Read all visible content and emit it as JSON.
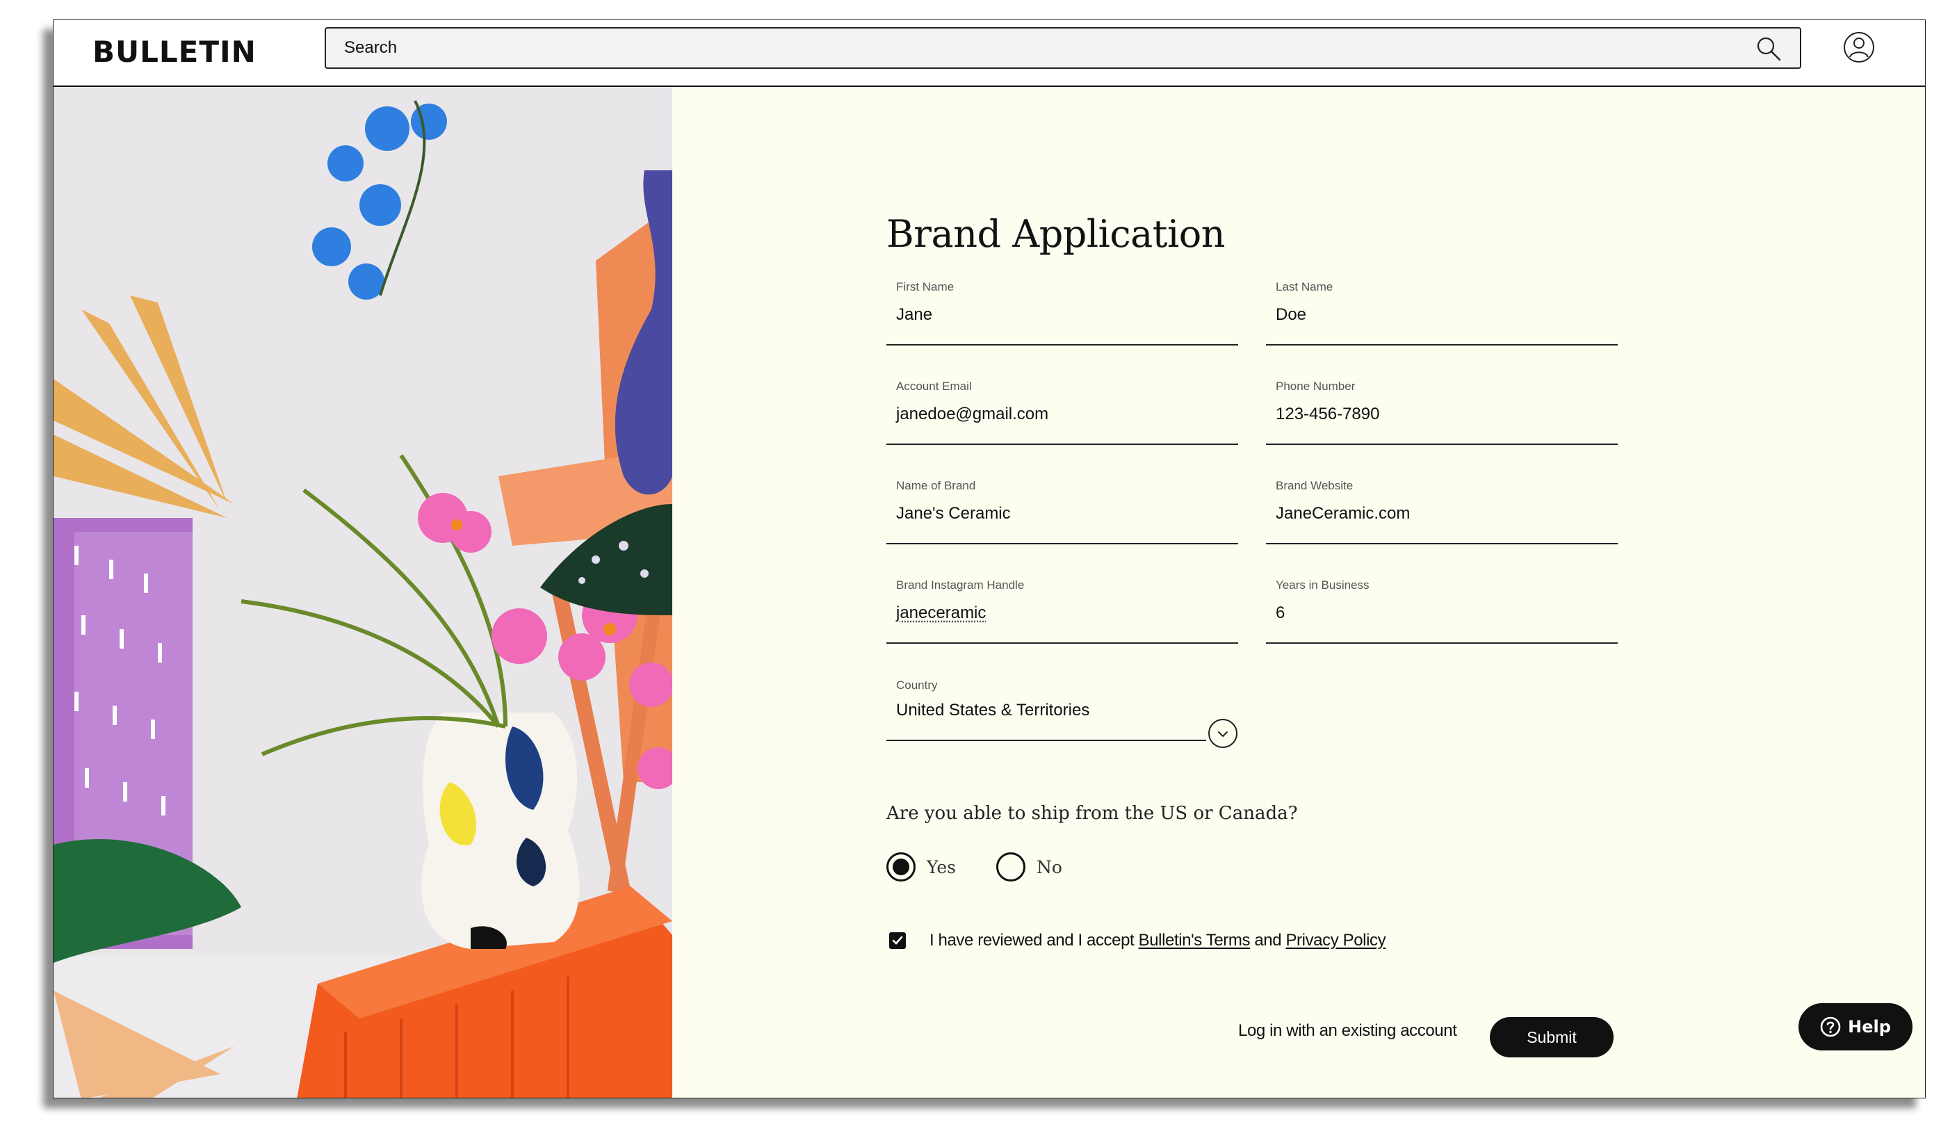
{
  "header": {
    "logo": "BULLETIN",
    "search_placeholder": "Search",
    "search_icon": "search-icon",
    "account_icon": "user-account-icon"
  },
  "hero_image": {
    "description_icon": "product-photo"
  },
  "form": {
    "title": "Brand Application",
    "fields": [
      {
        "label": "First Name",
        "value": "Jane"
      },
      {
        "label": "Last Name",
        "value": "Doe"
      },
      {
        "label": "Account Email",
        "value": "janedoe@gmail.com"
      },
      {
        "label": "Phone Number",
        "value": "123-456-7890"
      },
      {
        "label": "Name of Brand",
        "value": "Jane's Ceramic"
      },
      {
        "label": "Brand Website",
        "value": "JaneCeramic.com"
      },
      {
        "label": "Brand Instagram Handle",
        "value": "janeceramic"
      },
      {
        "label": "Years in Business",
        "value": "6"
      }
    ],
    "country": {
      "label": "Country",
      "value": "United States & Territories"
    },
    "ship_question": "Are you able to ship from the US or Canada?",
    "ship_options": [
      {
        "label": "Yes",
        "selected": true
      },
      {
        "label": "No",
        "selected": false
      }
    ],
    "terms": {
      "checked": true,
      "prefix": "I have reviewed and I accept ",
      "terms_link": "Bulletin's Terms",
      "joiner": " and ",
      "privacy_link": "Privacy Policy"
    },
    "login_link": "Log in with an existing account",
    "submit_label": "Submit"
  },
  "help": {
    "label": "Help"
  },
  "colors": {
    "form_background": "#fdfdf0",
    "button": "#111111",
    "accent_orange": "#f25a1e",
    "orchid_blue": "#2f7fe0",
    "orchid_pink": "#f06ab8"
  }
}
